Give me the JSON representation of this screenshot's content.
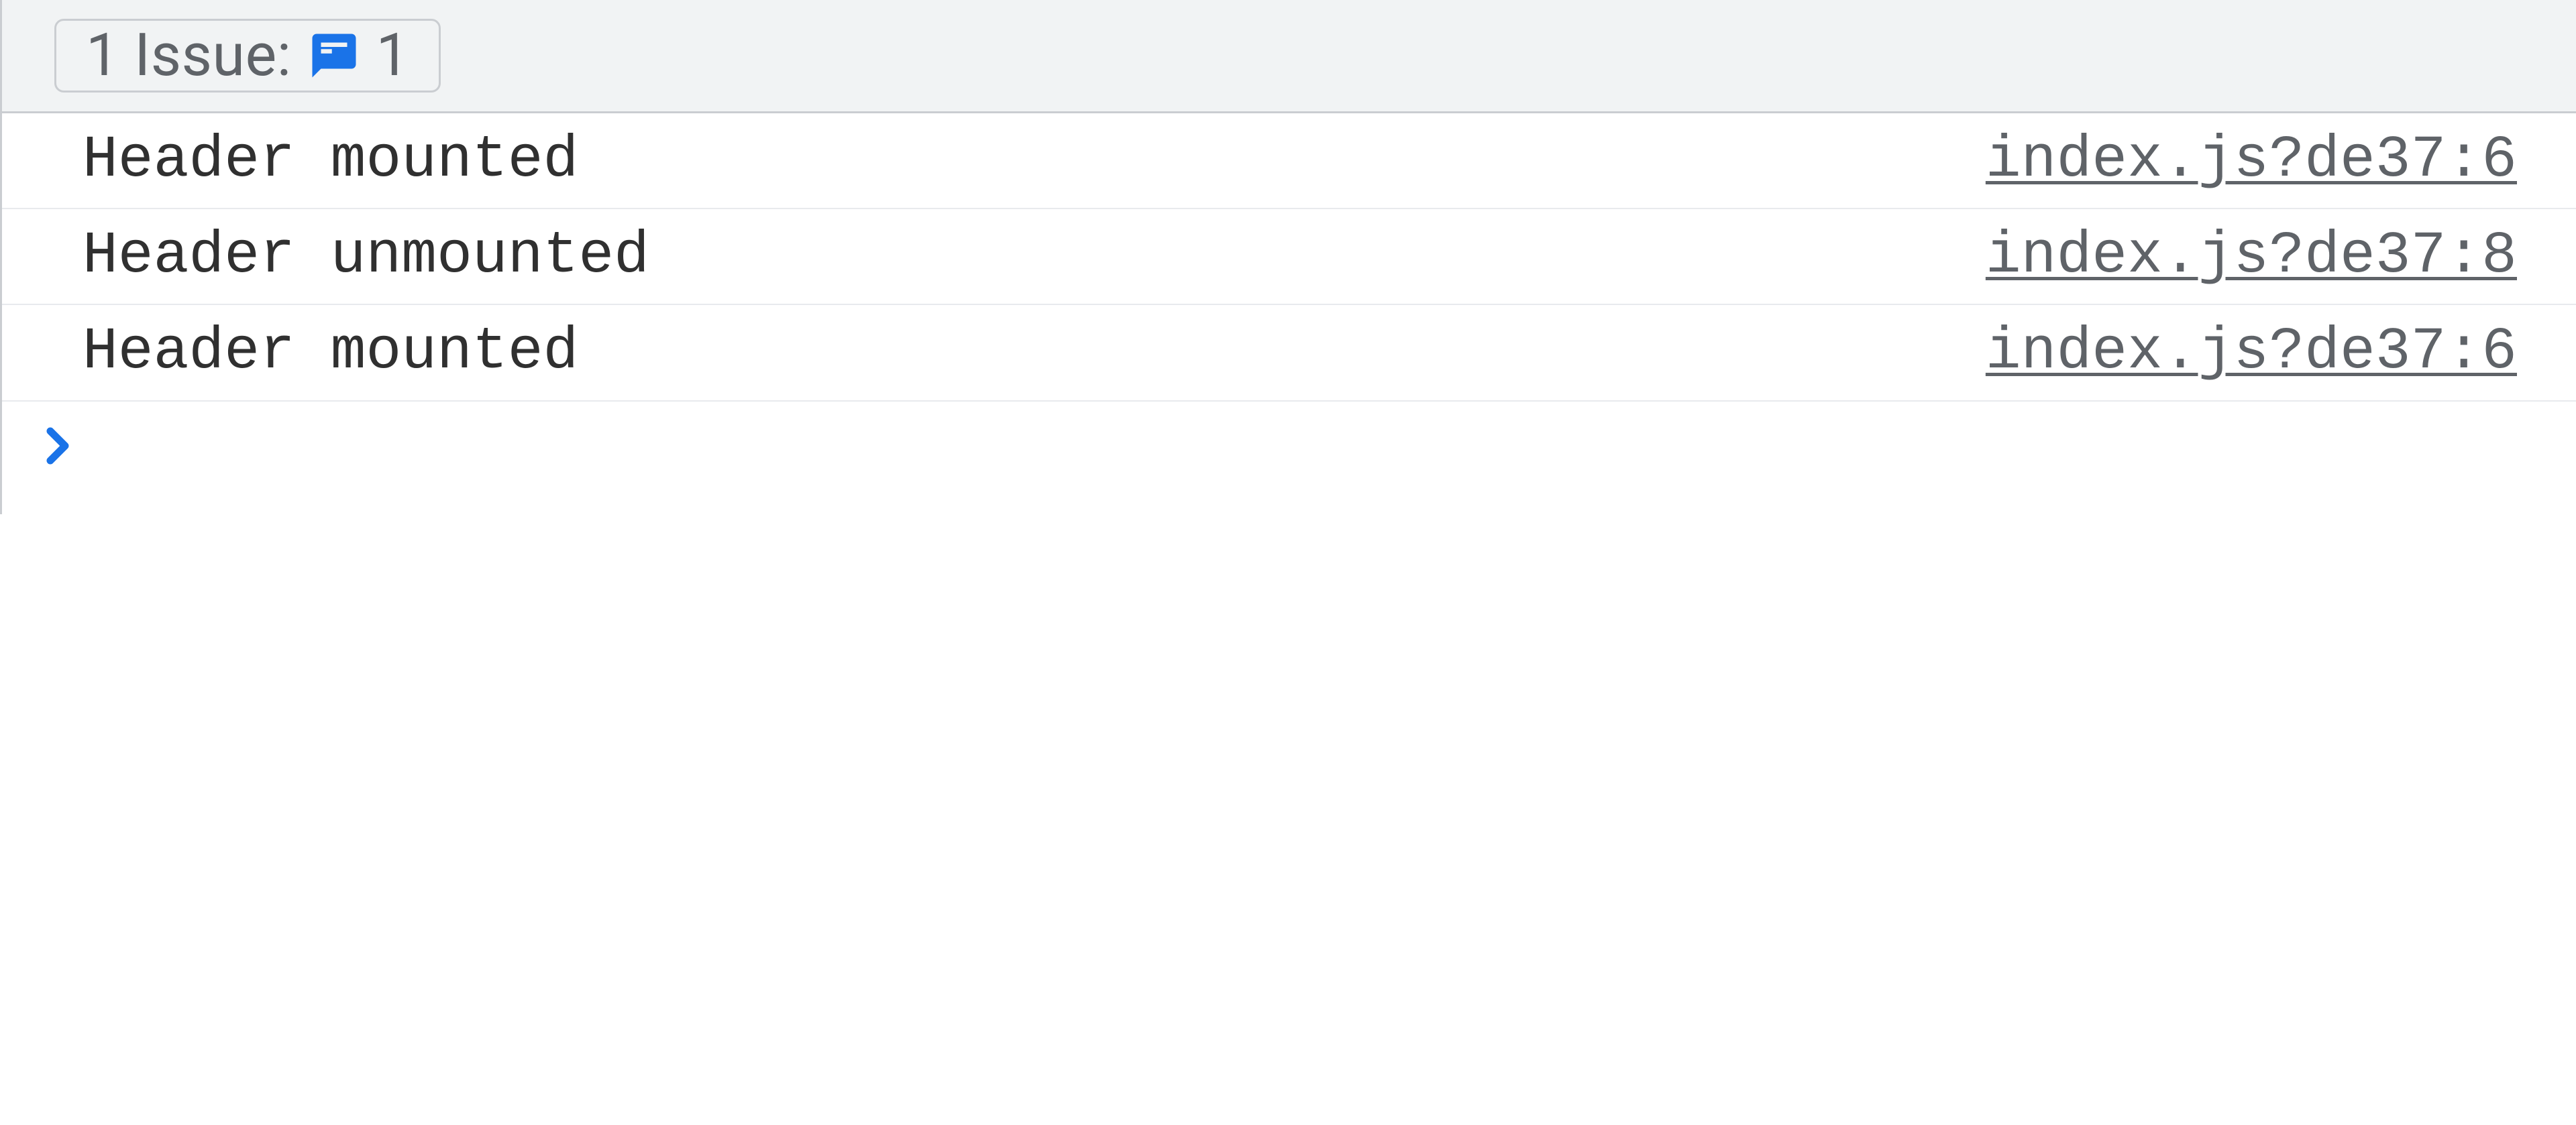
{
  "toolbar": {
    "issues_label": "1 Issue:",
    "issues_count": "1",
    "icon_color": "#1a73e8"
  },
  "logs": [
    {
      "message": "Header mounted",
      "source": "index.js?de37:6"
    },
    {
      "message": "Header unmounted",
      "source": "index.js?de37:8"
    },
    {
      "message": "Header mounted",
      "source": "index.js?de37:6"
    }
  ],
  "prompt": {
    "chevron_color": "#1a73e8"
  }
}
